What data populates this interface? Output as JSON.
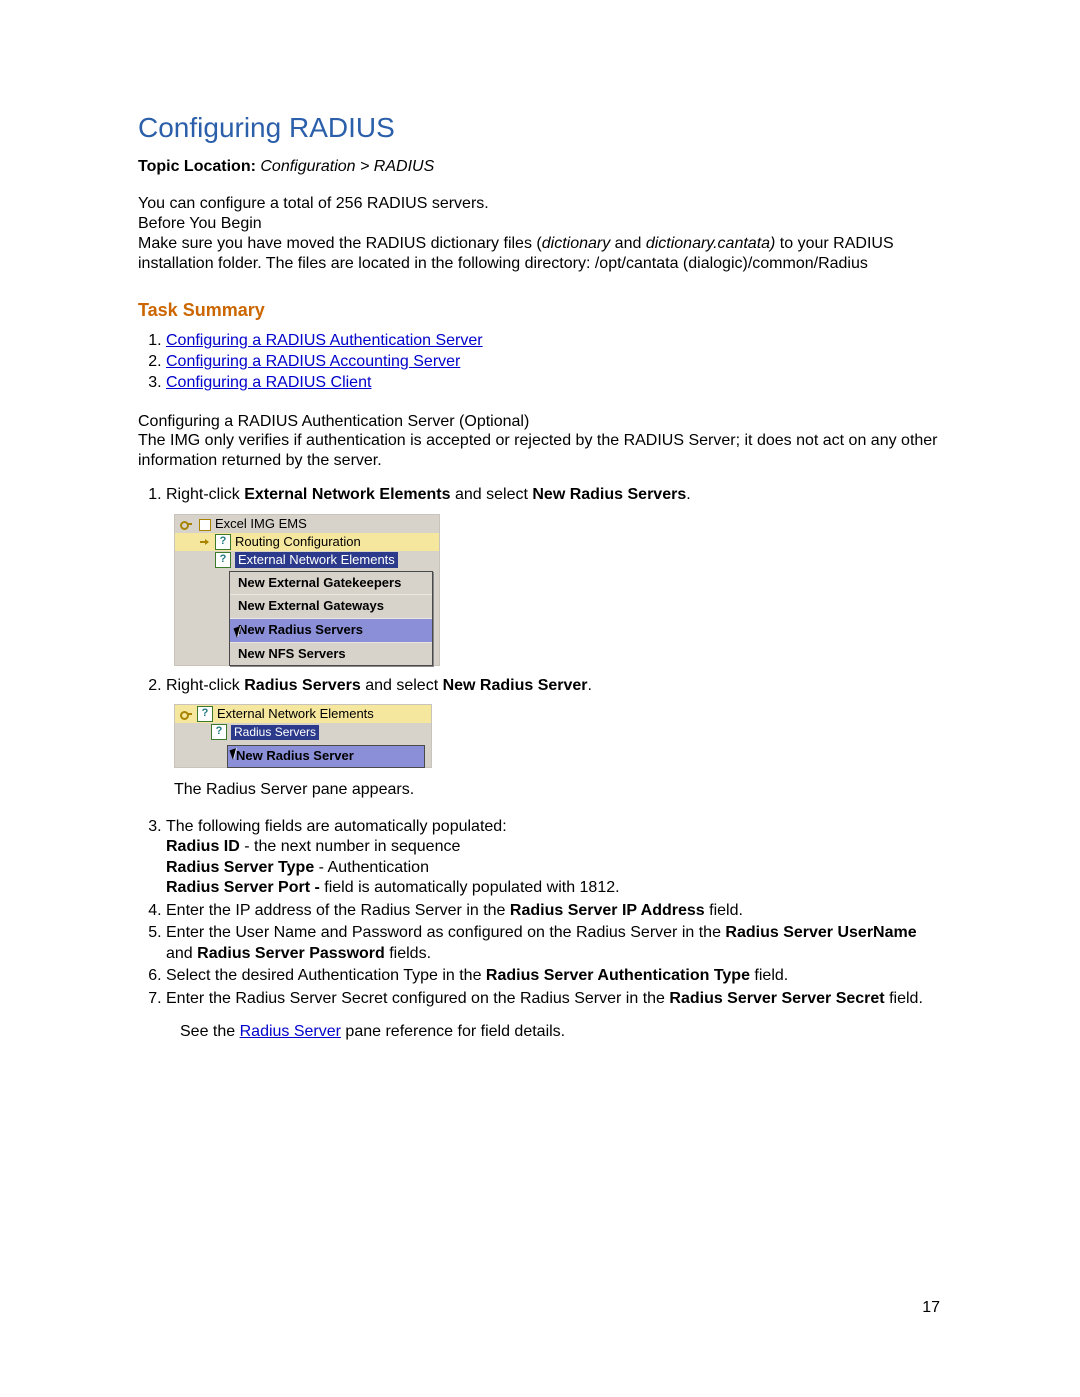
{
  "title": "Configuring RADIUS",
  "topic": {
    "label": "Topic Location:",
    "path": "Configuration > RADIUS"
  },
  "intro": {
    "line1": "You can configure a total of 256 RADIUS servers.",
    "line2": "Before You Begin",
    "pre": "Make sure you have moved the RADIUS dictionary files (",
    "it1": "dictionary",
    "mid": " and ",
    "it2": "dictionary.cantata)",
    "post": " to your RADIUS installation folder. The files are located in the following directory: /opt/cantata (dialogic)/common/Radius"
  },
  "taskHeading": "Task Summary",
  "taskLinks": [
    "Configuring a RADIUS Authentication Server",
    "Configuring a RADIUS Accounting Server",
    "Configuring a RADIUS Client"
  ],
  "subA": {
    "head": "Configuring a RADIUS Authentication Server (Optional)",
    "body": "The IMG only verifies if authentication is accepted or rejected by the RADIUS Server; it does not act on any other information returned by the server."
  },
  "stepsA": {
    "s1": {
      "pre": "Right-click ",
      "b1": "External Network Elements",
      "mid": " and select ",
      "b2": "New Radius Servers",
      "post": "."
    },
    "s2": {
      "pre": "Right-click ",
      "b1": "Radius Servers",
      "mid": " and select ",
      "b2": "New Radius Server",
      "post": "."
    },
    "caption2": "The Radius Server pane appears.",
    "s3": {
      "lead": "The following fields are automatically populated:",
      "f1b": "Radius ID",
      "f1t": " - the next number in sequence",
      "f2b": "Radius Server Type",
      "f2t": " - Authentication",
      "f3b": "Radius Server Port - ",
      "f3t": " field is automatically populated with 1812."
    },
    "s4": {
      "pre": "Enter the IP address of the Radius Server in the ",
      "b": "Radius Server IP Address",
      "post": " field."
    },
    "s5": {
      "pre": "Enter the User Name and Password as configured on the Radius Server in the ",
      "b1": "Radius Server UserName",
      "mid": " and ",
      "b2": "Radius Server Password",
      "post": " fields."
    },
    "s6": {
      "pre": "Select the desired Authentication Type in the ",
      "b": "Radius Server Authentication Type",
      "post": " field."
    },
    "s7": {
      "pre": "Enter the Radius Server Secret configured on the Radius Server in the ",
      "b": "Radius Server Server Secret",
      "post": " field."
    },
    "see": {
      "pre": "See the ",
      "link": "Radius Server",
      "post": " pane reference for field details."
    }
  },
  "shot1": {
    "root": "Excel IMG EMS",
    "node1": "Routing Configuration",
    "node2": "External Network Elements",
    "menu": [
      "New External Gatekeepers",
      "New External Gateways",
      "New Radius Servers",
      "New NFS Servers"
    ]
  },
  "shot2": {
    "root": "External Network Elements",
    "sel": "Radius Servers",
    "menu": [
      "New Radius Server"
    ]
  },
  "pageNumber": "17"
}
